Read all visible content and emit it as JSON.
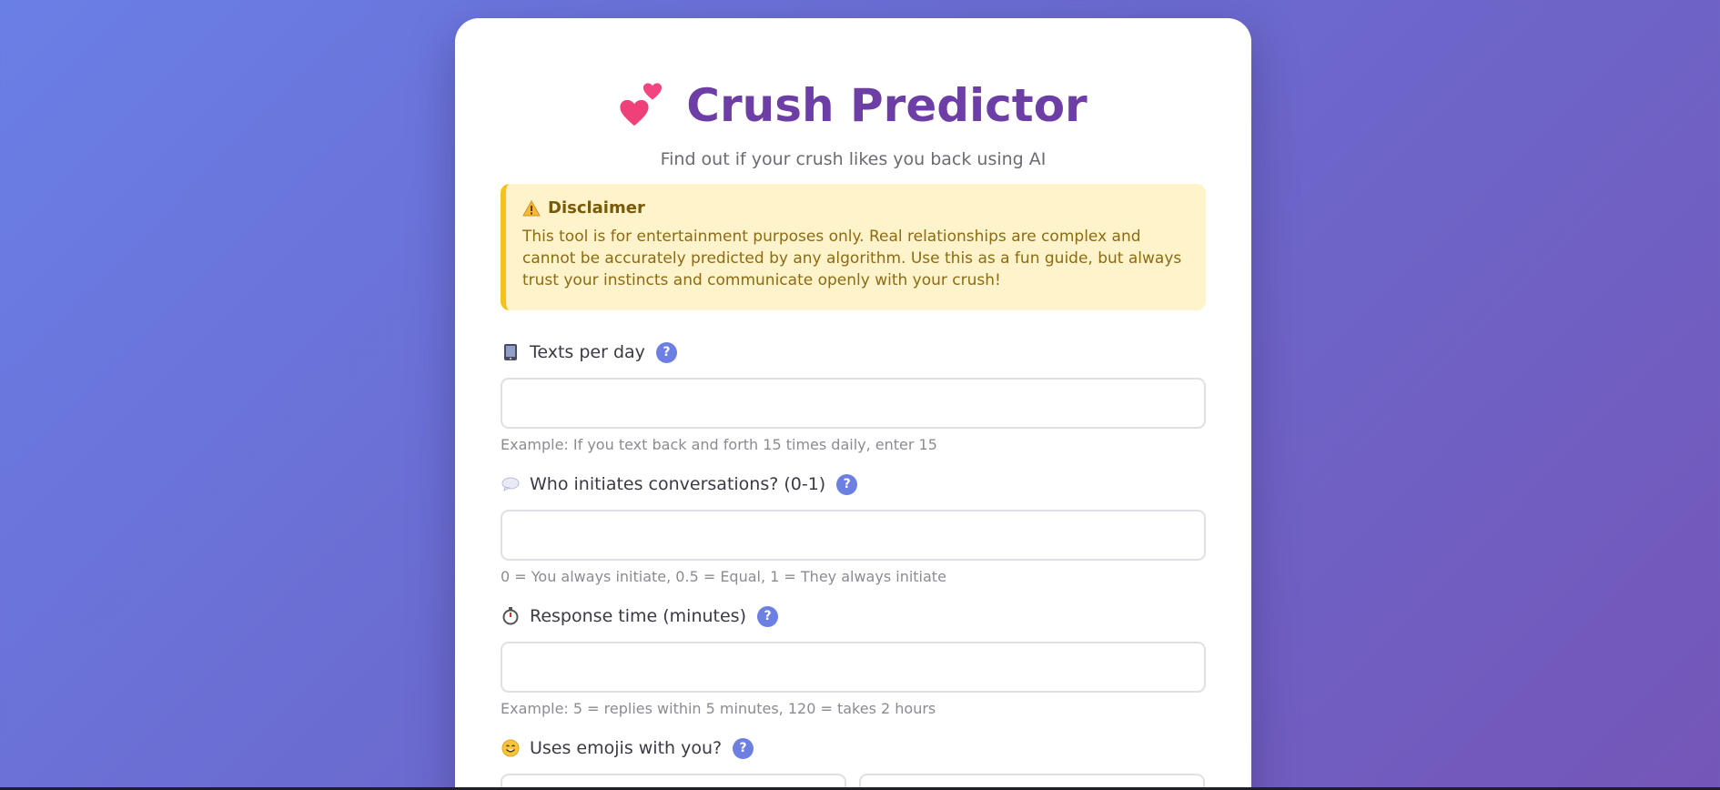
{
  "header": {
    "title": "Crush Predictor",
    "subtitle": "Find out if your crush likes you back using AI",
    "icon": "two-hearts-icon"
  },
  "disclaimer": {
    "icon": "warning-icon",
    "title": "Disclaimer",
    "text": "This tool is for entertainment purposes only. Real relationships are complex and cannot be accurately predicted by any algorithm. Use this as a fun guide, but always trust your instincts and communicate openly with your crush!"
  },
  "fields": {
    "texts_per_day": {
      "icon": "phone-icon",
      "label": "Texts per day",
      "help": "?",
      "value": "",
      "hint": "Example: If you text back and forth 15 times daily, enter 15"
    },
    "initiates": {
      "icon": "speech-bubble-icon",
      "label": "Who initiates conversations? (0-1)",
      "help": "?",
      "value": "",
      "hint": "0 = You always initiate, 0.5 = Equal, 1 = They always initiate"
    },
    "response_time": {
      "icon": "stopwatch-icon",
      "label": "Response time (minutes)",
      "help": "?",
      "value": "",
      "hint": "Example: 5 = replies within 5 minutes, 120 = takes 2 hours"
    },
    "emojis": {
      "icon": "smiley-icon",
      "label": "Uses emojis with you?",
      "help": "?"
    }
  },
  "colors": {
    "title": "#6d3ea6",
    "accent": "#6c80e3",
    "disclaimer_bg": "#fff3cc",
    "disclaimer_border": "#f3c21b"
  }
}
